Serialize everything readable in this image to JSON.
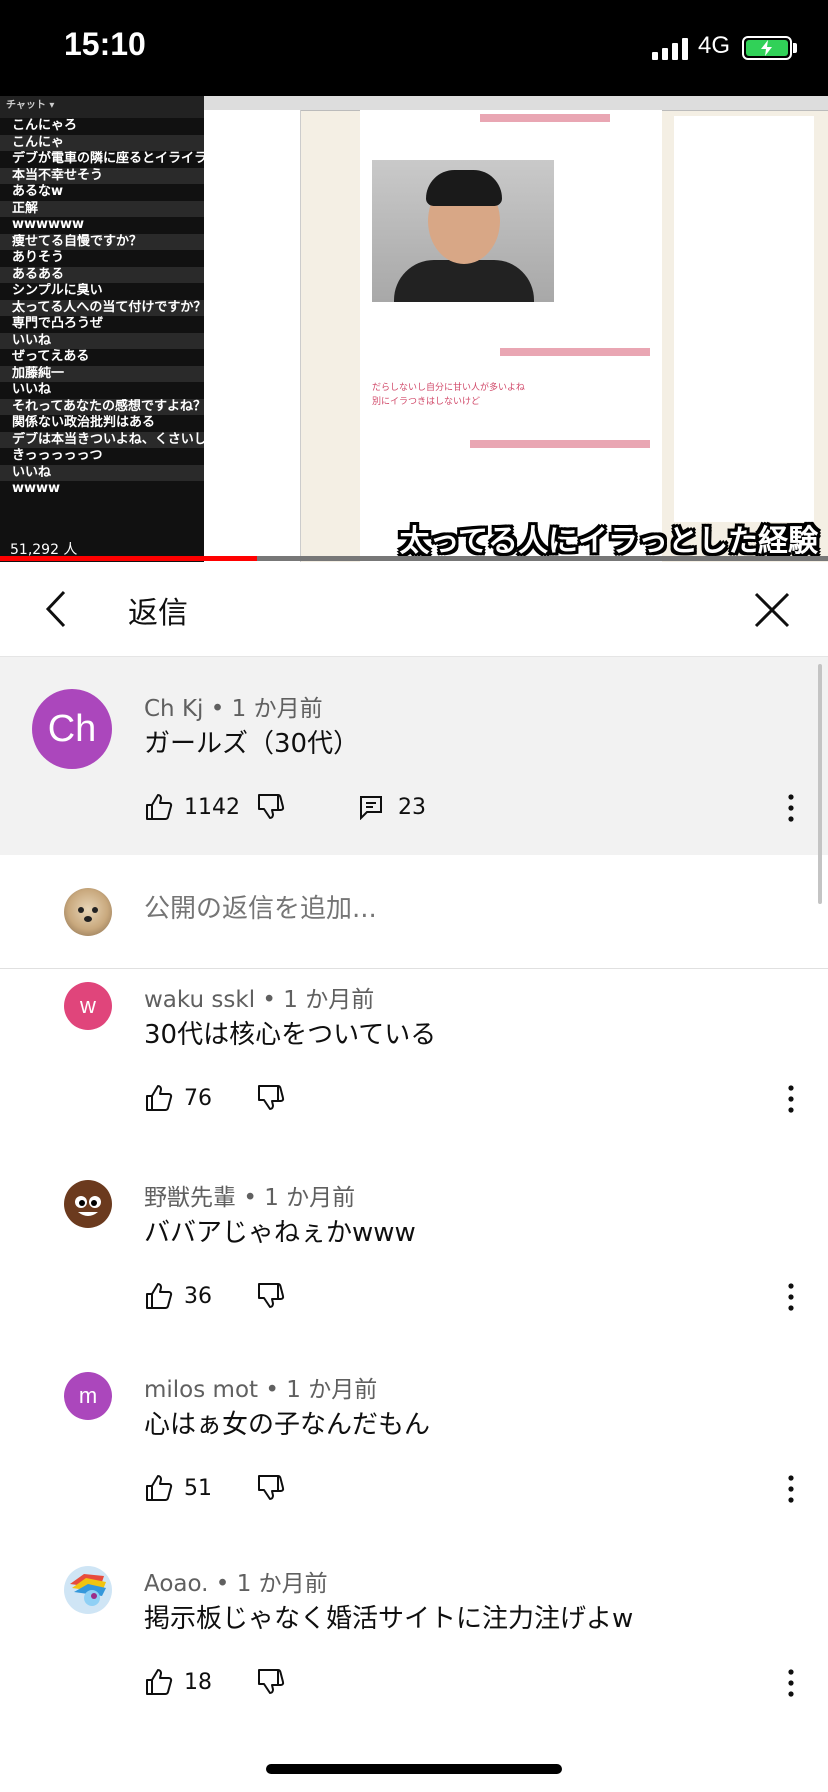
{
  "status_bar": {
    "time": "15:10",
    "network": "4G"
  },
  "video": {
    "chat_lines": [
      "こんにゃろ",
      "こんにゃ",
      "デブが電車の隣に座るとイライラ",
      "本当不幸せそう",
      "あるなw",
      "正解",
      "wwwwww",
      "痩せてる自慢ですか？",
      "ありそう",
      "あるある",
      "シンプルに臭い",
      "太ってる人への当て付けですか？",
      "専門で凸ろうぜ",
      "いいね",
      "ぜってえある",
      "加藤純一",
      "いいね",
      "それってあなたの感想ですよね？",
      "関係ない政治批判はある",
      "デブは本当きついよね、くさいし",
      "きっっっっっつ",
      "いいね",
      "wwww"
    ],
    "viewer_count": "51,292 人",
    "subtitle": "太ってる人にイラっとした経験",
    "progress": 0.31
  },
  "header": {
    "title": "返信"
  },
  "main_comment": {
    "avatar_text": "Ch",
    "author": "Ch Kj",
    "time": "1 か月前",
    "text": "ガールズ（30代）",
    "likes": "1142",
    "replies": "23"
  },
  "reply_box": {
    "placeholder": "公開の返信を追加..."
  },
  "replies": [
    {
      "avatar_text": "w",
      "avatar_color": "#e0457b",
      "author": "waku sskl",
      "time": "1 か月前",
      "text": "30代は核心をついている",
      "likes": "76"
    },
    {
      "avatar_text": "",
      "avatar_icon": "poop-emoji-avatar",
      "author": "野獣先輩",
      "time": "1 か月前",
      "text": "ババアじゃねぇかwww",
      "likes": "36"
    },
    {
      "avatar_text": "m",
      "avatar_color": "#ab47bc",
      "author": "milos mot",
      "time": "1 か月前",
      "text": "心はぁ女の子なんだもん",
      "likes": "51"
    },
    {
      "avatar_text": "",
      "avatar_icon": "pony-avatar",
      "author": "Aoao.",
      "time": "1 か月前",
      "text": "掲示板じゃなく婚活サイトに注力注げよw",
      "likes": "18"
    }
  ],
  "separator": "•",
  "colors": {
    "accent_red": "#ff0000",
    "highlight_bg": "#f2f2f2"
  }
}
